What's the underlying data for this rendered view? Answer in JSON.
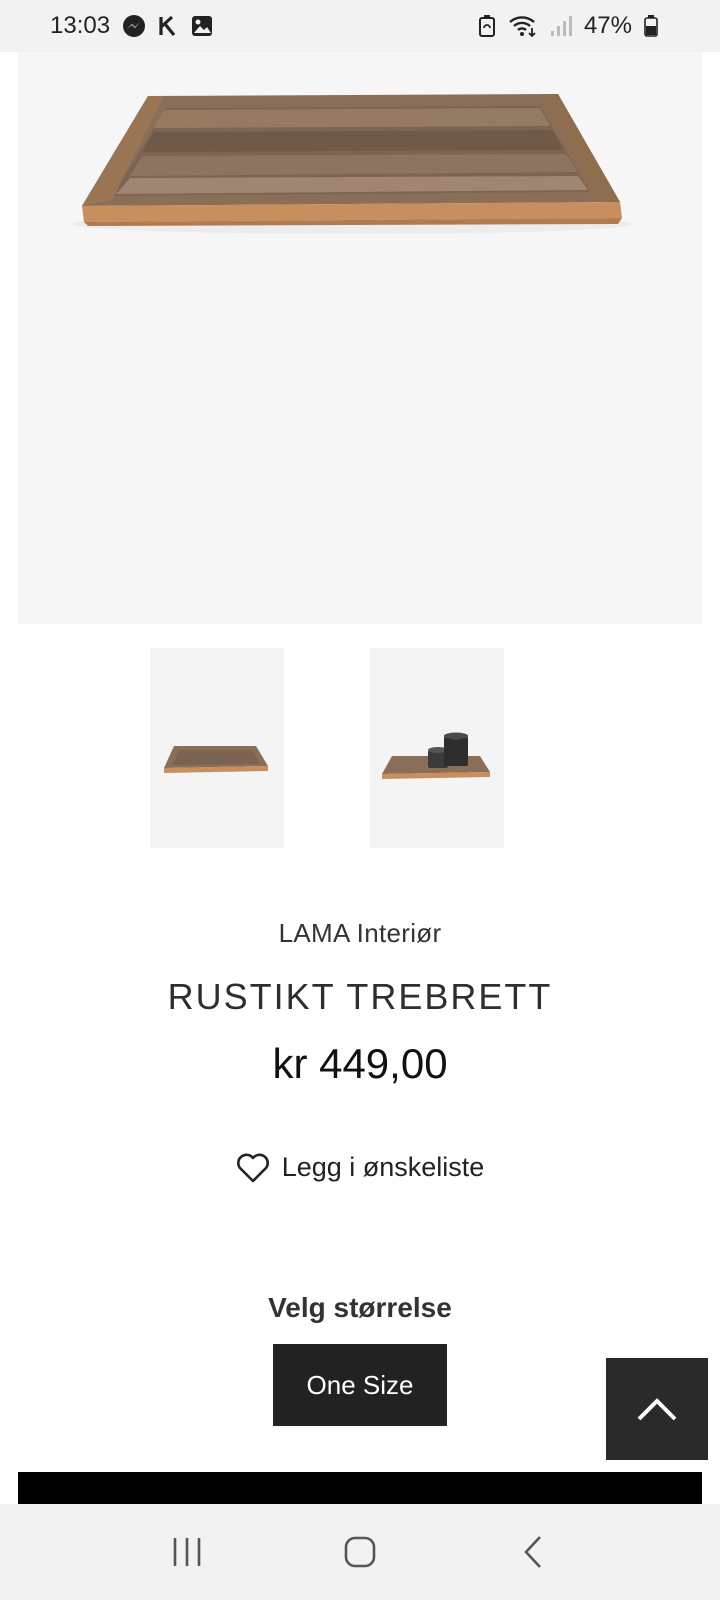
{
  "status_bar": {
    "time": "13:03",
    "left_icons": [
      "messenger-icon",
      "k-app-icon",
      "gallery-icon"
    ],
    "right_icons": [
      "battery-saver-icon",
      "wifi-icon",
      "signal-icon",
      "battery-icon"
    ],
    "battery_percent": "47%"
  },
  "product": {
    "brand": "LAMA Interiør",
    "title": "RUSTIKT TREBRETT",
    "price": "kr 449,00",
    "wishlist_label": "Legg i ønskeliste",
    "size_heading": "Velg størrelse",
    "sizes": [
      "One Size"
    ]
  },
  "nav_bar": {
    "buttons": [
      "recent-apps-icon",
      "home-icon",
      "back-icon"
    ]
  },
  "colors": {
    "dark_button": "#222222",
    "image_background": "#f6f6f6"
  }
}
